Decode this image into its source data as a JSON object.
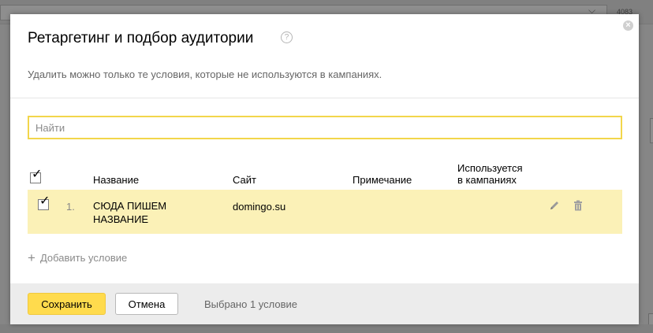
{
  "background": {
    "counter": "4083"
  },
  "dialog": {
    "title": "Ретаргетинг и подбор аудитории",
    "help_icon": "question-circle-icon",
    "close_icon": "close-circle-icon",
    "subtitle": "Удалить можно только те условия, которые не используются в кампаниях."
  },
  "search": {
    "placeholder": "Найти",
    "value": ""
  },
  "table": {
    "columns": {
      "name": "Название",
      "site": "Сайт",
      "note": "Примечание",
      "used_line1": "Используется",
      "used_line2": "в кампаниях"
    },
    "rows": [
      {
        "num": "1.",
        "name_line1": "СЮДА ПИШЕМ",
        "name_line2": "НАЗВАНИЕ",
        "site": "domingo.su",
        "note": "",
        "used": "",
        "checked": true
      }
    ]
  },
  "add_condition": {
    "icon": "plus-icon",
    "label": "Добавить условие"
  },
  "footer": {
    "save_label": "Сохранить",
    "cancel_label": "Отмена",
    "status": "Выбрано 1 условие"
  },
  "colors": {
    "accent_yellow": "#ffdb4d",
    "row_highlight": "#fbf1b7",
    "input_border": "#f2d64b"
  }
}
